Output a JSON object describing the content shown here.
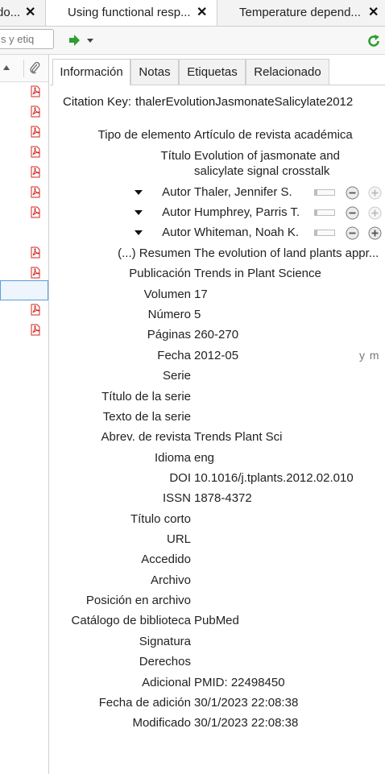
{
  "tabs": [
    {
      "label": "do...",
      "close": "✕"
    },
    {
      "label": "Using functional resp...",
      "close": "✕"
    },
    {
      "label": "Temperature depend...",
      "close": "✕"
    }
  ],
  "toolbar": {
    "search_placeholder": "s y etiq"
  },
  "items": [
    {
      "has_pdf": true,
      "selected": false
    },
    {
      "has_pdf": true,
      "selected": false
    },
    {
      "has_pdf": true,
      "selected": false
    },
    {
      "has_pdf": true,
      "selected": false
    },
    {
      "has_pdf": true,
      "selected": false
    },
    {
      "has_pdf": true,
      "selected": false
    },
    {
      "has_pdf": true,
      "selected": false
    },
    {
      "has_pdf": false,
      "selected": false
    },
    {
      "has_pdf": true,
      "selected": false
    },
    {
      "has_pdf": true,
      "selected": false
    },
    {
      "has_pdf": false,
      "selected": true
    },
    {
      "has_pdf": true,
      "selected": false
    },
    {
      "has_pdf": true,
      "selected": false
    }
  ],
  "detail": {
    "tabs": {
      "info": "Información",
      "notas": "Notas",
      "etiquetas": "Etiquetas",
      "relacionado": "Relacionado"
    },
    "citation_key_label": "Citation Key:",
    "citation_key": "thalerEvolutionJasmonateSalicylate2012",
    "item_type": {
      "label": "Tipo de elemento",
      "value": "Artículo de revista académica"
    },
    "title": {
      "label": "Título",
      "value": "Evolution of jasmonate and salicylate signal crosstalk"
    },
    "authors": [
      {
        "label": "Autor",
        "name": "Thaler, Jennifer S."
      },
      {
        "label": "Autor",
        "name": "Humphrey, Parris T."
      },
      {
        "label": "Autor",
        "name": "Whiteman, Noah K."
      }
    ],
    "fields": [
      {
        "label": "(...) Resumen",
        "value": "The evolution of land plants appr..."
      },
      {
        "label": "Publicación",
        "value": "Trends in Plant Science"
      },
      {
        "label": "Volumen",
        "value": "17"
      },
      {
        "label": "Número",
        "value": "5"
      },
      {
        "label": "Páginas",
        "value": "260-270"
      },
      {
        "label": "Fecha",
        "value": "2012-05"
      },
      {
        "label": "Serie",
        "value": ""
      },
      {
        "label": "Título de la serie",
        "value": ""
      },
      {
        "label": "Texto de la serie",
        "value": ""
      },
      {
        "label": "Abrev. de revista",
        "value": "Trends Plant Sci"
      },
      {
        "label": "Idioma",
        "value": "eng"
      },
      {
        "label": "DOI",
        "value": "10.1016/j.tplants.2012.02.010"
      },
      {
        "label": "ISSN",
        "value": "1878-4372"
      },
      {
        "label": "Título corto",
        "value": ""
      },
      {
        "label": "URL",
        "value": ""
      },
      {
        "label": "Accedido",
        "value": ""
      },
      {
        "label": "Archivo",
        "value": ""
      },
      {
        "label": "Posición en archivo",
        "value": ""
      },
      {
        "label": "Catálogo de biblioteca",
        "value": "PubMed"
      },
      {
        "label": "Signatura",
        "value": ""
      },
      {
        "label": "Derechos",
        "value": ""
      },
      {
        "label": "Adicional",
        "value": "PMID: 22498450"
      },
      {
        "label": "Fecha de adición",
        "value": "30/1/2023 22:08:38"
      },
      {
        "label": "Modificado",
        "value": "30/1/2023 22:08:38"
      }
    ],
    "date_order": "y m"
  },
  "colors": {
    "pdf_red": "#d4261f",
    "arrow_green": "#2f9e2f",
    "selection_border": "#5d9ddb"
  }
}
